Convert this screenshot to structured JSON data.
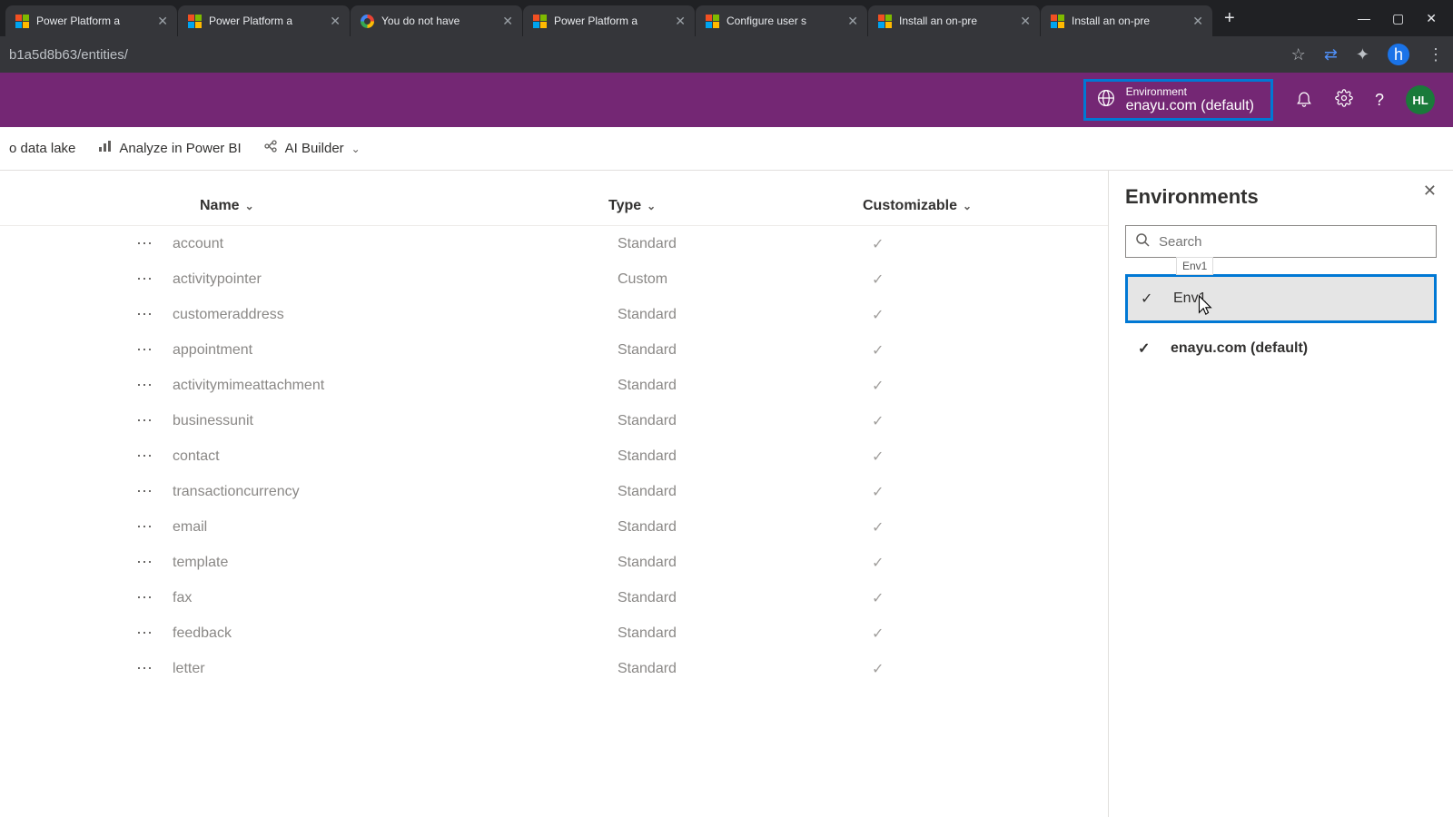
{
  "browser": {
    "tabs": [
      {
        "title": "Power Platform a",
        "fav": "ms"
      },
      {
        "title": "Power Platform a",
        "fav": "ms"
      },
      {
        "title": "You do not have",
        "fav": "g"
      },
      {
        "title": "Power Platform a",
        "fav": "ms"
      },
      {
        "title": "Configure user s",
        "fav": "ms"
      },
      {
        "title": "Install an on-pre",
        "fav": "ms"
      },
      {
        "title": "Install an on-pre",
        "fav": "ms"
      }
    ],
    "url": "b1a5d8b63/entities/",
    "profile_letter": "h"
  },
  "header": {
    "env_label": "Environment",
    "env_value": "enayu.com (default)",
    "avatar": "HL"
  },
  "commands": {
    "data_lake": "o data lake",
    "power_bi": "Analyze in Power BI",
    "ai_builder": "AI Builder"
  },
  "table": {
    "columns": {
      "name": "Name",
      "type": "Type",
      "customizable": "Customizable"
    },
    "rows": [
      {
        "name": "account",
        "type": "Standard"
      },
      {
        "name": "activitypointer",
        "type": "Custom"
      },
      {
        "name": "customeraddress",
        "type": "Standard"
      },
      {
        "name": "appointment",
        "type": "Standard"
      },
      {
        "name": "activitymimeattachment",
        "type": "Standard"
      },
      {
        "name": "businessunit",
        "type": "Standard"
      },
      {
        "name": "contact",
        "type": "Standard"
      },
      {
        "name": "transactioncurrency",
        "type": "Standard"
      },
      {
        "name": "email",
        "type": "Standard"
      },
      {
        "name": "template",
        "type": "Standard"
      },
      {
        "name": "fax",
        "type": "Standard"
      },
      {
        "name": "feedback",
        "type": "Standard"
      },
      {
        "name": "letter",
        "type": "Standard"
      }
    ]
  },
  "panel": {
    "title": "Environments",
    "search_placeholder": "Search",
    "tooltip": "Env1",
    "items": [
      {
        "label": "Env1",
        "selected": true
      },
      {
        "label": "enayu.com (default)",
        "selected": false
      }
    ]
  }
}
